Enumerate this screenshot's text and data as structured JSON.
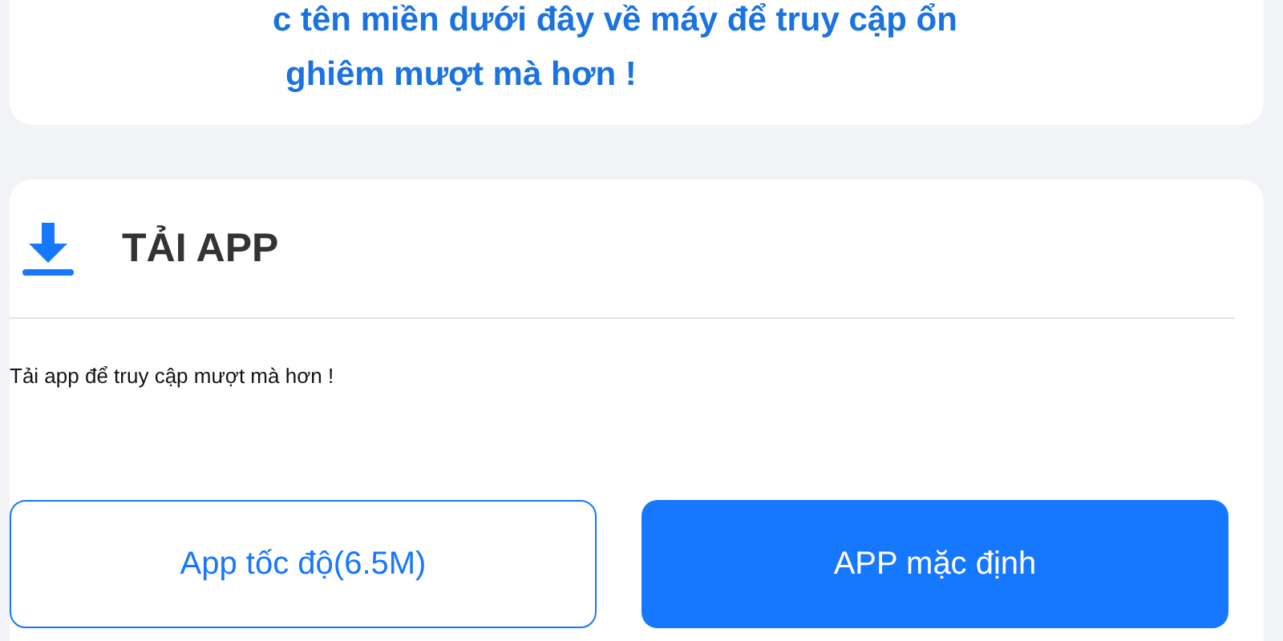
{
  "notice": {
    "lines": [
      "c tên miền dưới đây về máy để truy cập ổn",
      "ghiêm mượt mà hơn !"
    ]
  },
  "download": {
    "title": "TẢI APP",
    "description": "Tải app để truy cập mượt mà hơn !",
    "buttons": [
      {
        "label": "App tốc độ(6.5M)",
        "kind": "outline"
      },
      {
        "label": "APP mặc định",
        "kind": "primary"
      }
    ]
  }
}
